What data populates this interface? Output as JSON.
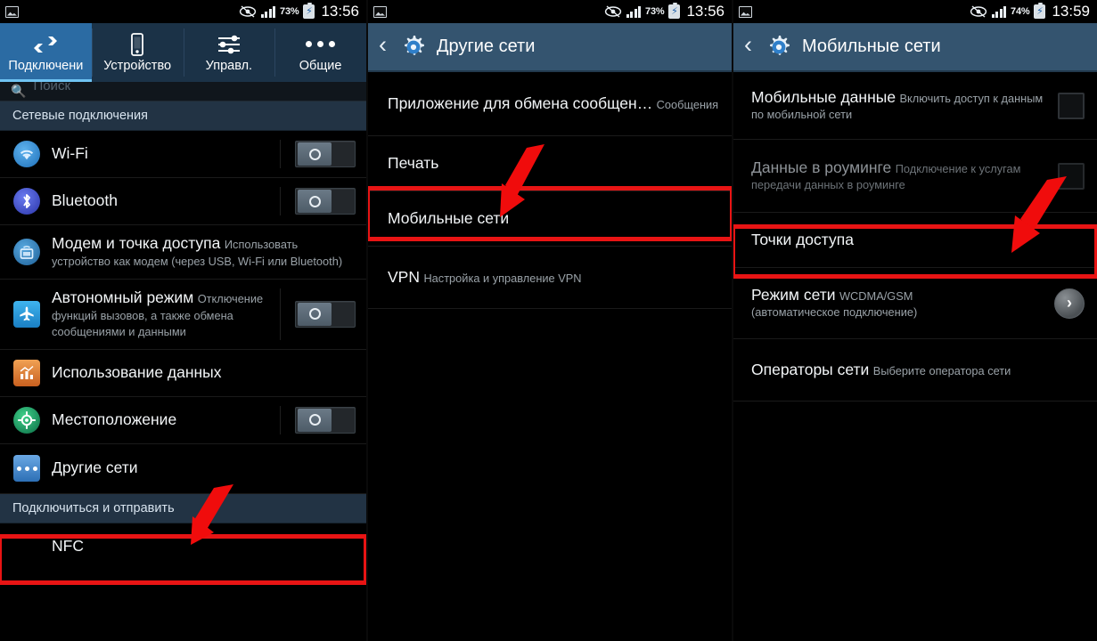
{
  "colors": {
    "accent_blue": "#2b6ba3",
    "actionbar_blue": "#34546f",
    "tabbar_blue": "#1b3247",
    "section_header": "#223344",
    "highlight_red": "#e81414",
    "text_primary": "#f2f5f7",
    "text_secondary": "#9aa2a8"
  },
  "panel1": {
    "statusbar": {
      "picture_icon": "picture-icon",
      "eye_icon": "eye-icon",
      "signal_icon": "signal-bars-icon",
      "battery_percent": "73%",
      "battery_icon": "battery-charging-icon",
      "time": "13:56"
    },
    "tabs": [
      {
        "label": "Подключени",
        "icon": "connections-arrows-icon",
        "active": true
      },
      {
        "label": "Устройство",
        "icon": "phone-icon",
        "active": false
      },
      {
        "label": "Управл.",
        "icon": "sliders-icon",
        "active": false
      },
      {
        "label": "Общие",
        "icon": "three-dots-icon",
        "active": false
      }
    ],
    "search": {
      "placeholder": "Поиск",
      "icon": "search-icon"
    },
    "section_title": "Сетевые подключения",
    "rows": [
      {
        "title": "Wi-Fi",
        "sub": "",
        "icon": "wifi-icon",
        "control": "toggle",
        "toggle_on": false
      },
      {
        "title": "Bluetooth",
        "sub": "",
        "icon": "bluetooth-icon",
        "control": "toggle",
        "toggle_on": false
      },
      {
        "title": "Модем и точка доступа",
        "sub": "Использовать устройство как модем (через USB, Wi-Fi или Bluetooth)",
        "icon": "tethering-icon",
        "control": "none"
      },
      {
        "title": "Автономный режим",
        "sub": "Отключение функций вызовов, а также обмена сообщениями и данными",
        "icon": "airplane-icon",
        "control": "toggle",
        "toggle_on": false
      },
      {
        "title": "Использование данных",
        "sub": "",
        "icon": "data-usage-icon",
        "control": "none"
      },
      {
        "title": "Местоположение",
        "sub": "",
        "icon": "location-icon",
        "control": "toggle",
        "toggle_on": false
      },
      {
        "title": "Другие сети",
        "sub": "",
        "icon": "other-networks-icon",
        "control": "none",
        "highlighted": true
      }
    ],
    "section_title2": "Подключиться и отправить",
    "row_nfc": {
      "title": "NFC"
    }
  },
  "panel2": {
    "statusbar": {
      "picture_icon": "picture-icon",
      "eye_icon": "eye-icon",
      "signal_icon": "signal-bars-icon",
      "battery_percent": "73%",
      "battery_icon": "battery-charging-icon",
      "time": "13:56"
    },
    "actionbar": {
      "back_icon": "back-chevron-icon",
      "gear_icon": "settings-gear-icon",
      "title": "Другие сети"
    },
    "rows": [
      {
        "title": "Приложение для обмена сообщен…",
        "sub": "Сообщения"
      },
      {
        "title": "Печать",
        "sub": ""
      },
      {
        "title": "Мобильные сети",
        "sub": "",
        "highlighted": true
      },
      {
        "title": "VPN",
        "sub": "Настройка и управление VPN"
      }
    ]
  },
  "panel3": {
    "statusbar": {
      "picture_icon": "picture-icon",
      "eye_icon": "eye-icon",
      "signal_icon": "signal-bars-icon",
      "battery_percent": "74%",
      "battery_icon": "battery-charging-icon",
      "time": "13:59"
    },
    "actionbar": {
      "back_icon": "back-chevron-icon",
      "gear_icon": "settings-gear-icon",
      "title": "Мобильные сети"
    },
    "rows": [
      {
        "title": "Мобильные данные",
        "sub": "Включить доступ к данным по мобильной сети",
        "control": "checkbox",
        "checked": false,
        "disabled": false
      },
      {
        "title": "Данные в роуминге",
        "sub": "Подключение к услугам передачи данных в роуминге",
        "control": "checkbox",
        "checked": false,
        "disabled": true
      },
      {
        "title": "Точки доступа",
        "sub": "",
        "control": "none",
        "highlighted": true
      },
      {
        "title": "Режим сети",
        "sub": "WCDMA/GSM\n(автоматическое подключение)",
        "control": "chevron"
      },
      {
        "title": "Операторы сети",
        "sub": "Выберите оператора сети",
        "control": "none"
      }
    ]
  }
}
